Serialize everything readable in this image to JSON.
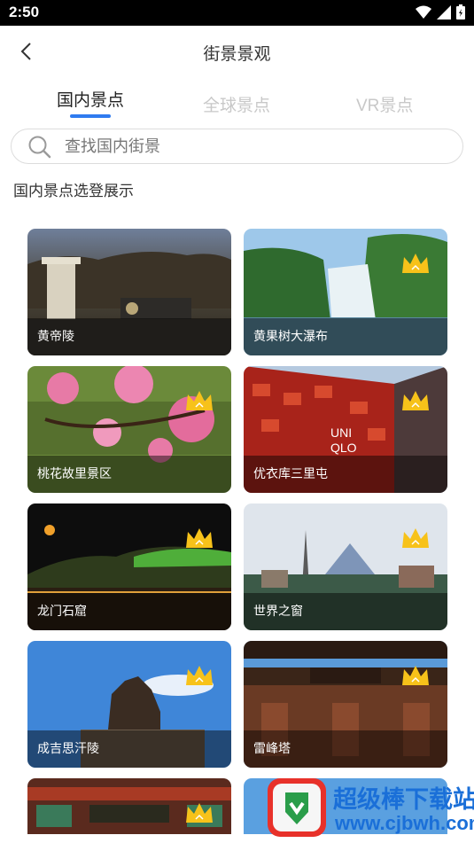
{
  "status_bar": {
    "time": "2:50"
  },
  "header": {
    "title": "街景景观"
  },
  "tabs": [
    {
      "label": "国内景点",
      "active": true
    },
    {
      "label": "全球景点",
      "active": false
    },
    {
      "label": "VR景点",
      "active": false
    }
  ],
  "search": {
    "placeholder": "查找国内街景"
  },
  "section": {
    "title": "国内景点选登展示"
  },
  "cards": [
    {
      "label": "黄帝陵",
      "vip": false
    },
    {
      "label": "黄果树大瀑布",
      "vip": true
    },
    {
      "label": "桃花故里景区",
      "vip": true
    },
    {
      "label": "优衣库三里屯",
      "vip": true
    },
    {
      "label": "龙门石窟",
      "vip": true
    },
    {
      "label": "世界之窗",
      "vip": true
    },
    {
      "label": "成吉思汗陵",
      "vip": true
    },
    {
      "label": "雷峰塔",
      "vip": true
    },
    {
      "label": "",
      "vip": true
    },
    {
      "label": "",
      "vip": true
    }
  ],
  "watermark": {
    "title": "超级棒下载站",
    "url": "www.cjbwh.com"
  },
  "colors": {
    "accent": "#2f7bf0",
    "crown": "#f7c21a"
  }
}
